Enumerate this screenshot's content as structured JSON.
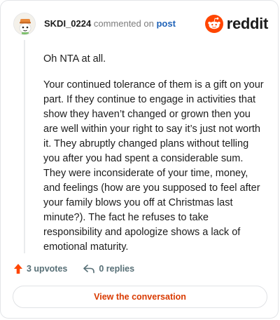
{
  "header": {
    "username": "SKDI_0224",
    "action_text": "commented on",
    "post_link": "post",
    "brand": "reddit",
    "avatar_icon": "snoo-avatar-icon",
    "brand_icon": "reddit-snoo-logo-icon"
  },
  "comment": {
    "paragraphs": [
      "Oh NTA at all.",
      "Your continued tolerance of them is a gift on your part. If they continue to engage in activities that show they haven’t changed or grown then you are well within your right to say it’s just not worth it. They abruptly changed plans without telling you after you had spent a considerable sum. They were inconsiderate of your time, money, and feelings (how are you supposed to feel after your family blows you off at Christmas last minute?). The fact he refuses to take responsibility and apologize shows a lack of emotional maturity."
    ]
  },
  "actions": {
    "upvotes": "3 upvotes",
    "replies": "0 replies",
    "upvote_icon": "upvote-arrow-icon",
    "reply_icon": "reply-arrow-icon"
  },
  "cta": {
    "label": "View the conversation"
  },
  "colors": {
    "reddit_orange": "#ff4500",
    "link_blue": "#1f62b8",
    "cta_text": "#d93a00",
    "muted": "#576f76"
  }
}
